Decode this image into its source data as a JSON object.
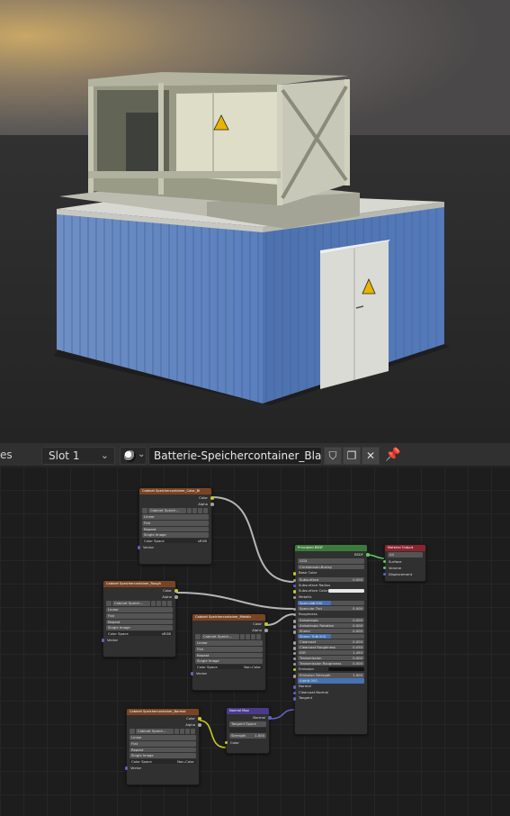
{
  "viewport": {
    "title": "3D render preview"
  },
  "header": {
    "truncated_label": "es",
    "slot_label": "Slot 1",
    "material_name": "Batterie-Speichercontainer_Blau",
    "icons": [
      "material-browse-icon",
      "fake-user-shield-icon",
      "duplicate-icon",
      "close-icon",
      "pin-icon"
    ]
  },
  "nodes": {
    "tex1": {
      "title": "Cabinet Speichercontainer_Color_Bl",
      "out_color": "Color",
      "out_alpha": "Alpha",
      "image": "Cabinet Speich...",
      "opts": [
        "Linear",
        "Flat",
        "Repeat",
        "Single Image"
      ],
      "cs_label": "Color Space",
      "cs_value": "sRGB",
      "vector": "Vector"
    },
    "tex2": {
      "title": "Cabinet Speichercontainer_Rough",
      "out_color": "Color",
      "out_alpha": "Alpha",
      "image": "Cabinet Speich...",
      "opts": [
        "Linear",
        "Flat",
        "Repeat",
        "Single Image"
      ],
      "cs_label": "Color Space",
      "cs_value": "sRGB",
      "vector": "Vector"
    },
    "tex3": {
      "title": "Cabinet Speichercontainer_Metalic",
      "out_color": "Color",
      "out_alpha": "Alpha",
      "image": "Cabinet Speich...",
      "opts": [
        "Linear",
        "Flat",
        "Repeat",
        "Single Image"
      ],
      "cs_label": "Color Space",
      "cs_value": "Non-Color",
      "vector": "Vector"
    },
    "tex4": {
      "title": "Cabinet Speichercontainer_Normal",
      "out_color": "Color",
      "out_alpha": "Alpha",
      "image": "Cabinet Speich...",
      "opts": [
        "Linear",
        "Flat",
        "Repeat",
        "Single Image"
      ],
      "cs_label": "Color Space",
      "cs_value": "Non-Color",
      "vector": "Vector"
    },
    "normalmap": {
      "title": "Normal Map",
      "out_normal": "Normal",
      "space": "Tangent Space",
      "strength_label": "Strength",
      "strength": "1.000",
      "color": "Color"
    },
    "bsdf": {
      "title": "Principled BSDF",
      "out": "BSDF",
      "distribution": "GGX",
      "subsurface_method": "Christensen-Burley",
      "rows": [
        {
          "label": "Base Color",
          "value": ""
        },
        {
          "label": "Subsurface",
          "value": "0.000"
        },
        {
          "label": "Subsurface Radius",
          "value": ""
        },
        {
          "label": "Subsurface Color",
          "value": ""
        },
        {
          "label": "Metallic",
          "value": ""
        },
        {
          "label": "Specular",
          "value": "0.500"
        },
        {
          "label": "Specular Tint",
          "value": "0.000"
        },
        {
          "label": "Roughness",
          "value": ""
        },
        {
          "label": "Anisotropic",
          "value": "0.000"
        },
        {
          "label": "Anisotropic Rotation",
          "value": "0.000"
        },
        {
          "label": "Sheen",
          "value": "0.000"
        },
        {
          "label": "Sheen Tint",
          "value": "0.500"
        },
        {
          "label": "Clearcoat",
          "value": "0.000"
        },
        {
          "label": "Clearcoat Roughness",
          "value": "0.030"
        },
        {
          "label": "IOR",
          "value": "1.450"
        },
        {
          "label": "Transmission",
          "value": "0.000"
        },
        {
          "label": "Transmission Roughness",
          "value": "0.000"
        },
        {
          "label": "Emission",
          "value": ""
        },
        {
          "label": "Emission Strength",
          "value": "1.000"
        },
        {
          "label": "Alpha",
          "value": "1.000"
        },
        {
          "label": "Normal",
          "value": ""
        },
        {
          "label": "Clearcoat Normal",
          "value": ""
        },
        {
          "label": "Tangent",
          "value": ""
        }
      ]
    },
    "output": {
      "title": "Material Output",
      "target": "All",
      "inputs": [
        "Surface",
        "Volume",
        "Displacement"
      ]
    }
  }
}
